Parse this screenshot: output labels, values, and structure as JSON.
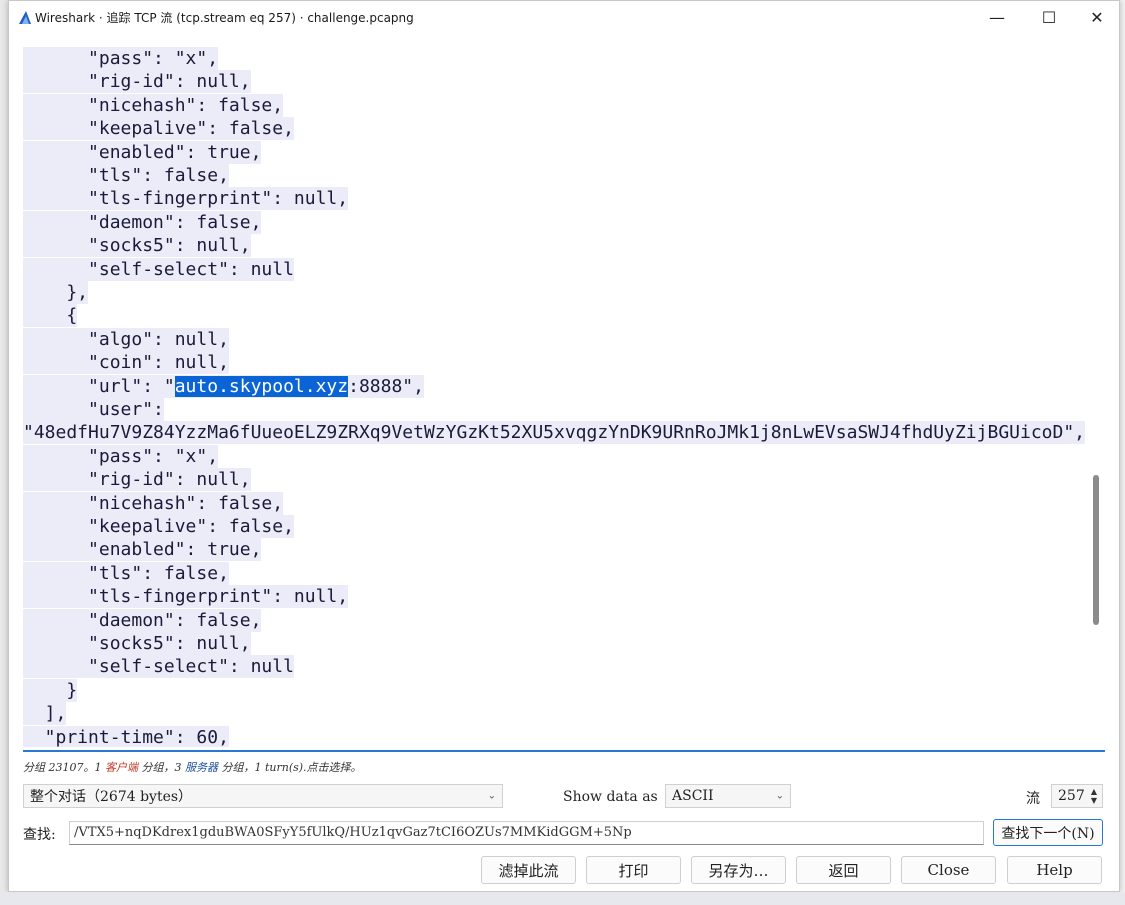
{
  "window": {
    "title": "Wireshark · 追踪 TCP 流 (tcp.stream eq 257) · challenge.pcapng",
    "controls": {
      "minimize": "—",
      "maximize": "☐",
      "close": "✕"
    }
  },
  "stream_text": {
    "lines": [
      "      \"pass\": \"x\",",
      "      \"rig-id\": null,",
      "      \"nicehash\": false,",
      "      \"keepalive\": false,",
      "      \"enabled\": true,",
      "      \"tls\": false,",
      "      \"tls-fingerprint\": null,",
      "      \"daemon\": false,",
      "      \"socks5\": null,",
      "      \"self-select\": null",
      "    },",
      "    {",
      "      \"algo\": null,",
      "      \"coin\": null,",
      "      \"url\": \"auto.skypool.xyz:8888\",",
      "      \"user\":",
      "\"48edfHu7V9Z84YzzMa6fUueoELZ9ZRXq9VetWzYGzKt52XU5xvqgzYnDK9URnRoJMk1j8nLwEVsaSWJ4fhdUyZijBGUicoD\",",
      "      \"pass\": \"x\",",
      "      \"rig-id\": null,",
      "      \"nicehash\": false,",
      "      \"keepalive\": false,",
      "      \"enabled\": true,",
      "      \"tls\": false,",
      "      \"tls-fingerprint\": null,",
      "      \"daemon\": false,",
      "      \"socks5\": null,",
      "      \"self-select\": null",
      "    }",
      "  ],",
      "  \"print-time\": 60,"
    ],
    "highlight": {
      "line_index": 14,
      "before": "      \"url\": \"",
      "match": "auto.skypool.xyz",
      "after": ":8888\","
    }
  },
  "status": {
    "prefix": "分组 23107。1 ",
    "client": "客户端",
    "middle": " 分组，3 ",
    "server": "服务器",
    "suffix": " 分组，1 turn(s).点击选择。"
  },
  "conversation_select": {
    "value": "整个对话（2674 bytes）"
  },
  "show_data_as": {
    "label": "Show data as",
    "value": "ASCII"
  },
  "stream": {
    "label": "流",
    "value": "257"
  },
  "find": {
    "label": "查找:",
    "value": "/VTX5+nqDKdrex1gduBWA0SFyY5fUlkQ/HUz1qvGaz7tCI6OZUs7MMKidGGM+5Np",
    "next_button": "查找下一个(N)"
  },
  "buttons": {
    "filter_out": "滤掉此流",
    "print": "打印",
    "save_as": "另存为…",
    "back": "返回",
    "close": "Close",
    "help": "Help"
  },
  "colors": {
    "text_bg": "#ececf8",
    "highlight": "#0a64d6",
    "accent": "#2a78d6",
    "client": "#c0392b",
    "server": "#1f4e9a"
  }
}
